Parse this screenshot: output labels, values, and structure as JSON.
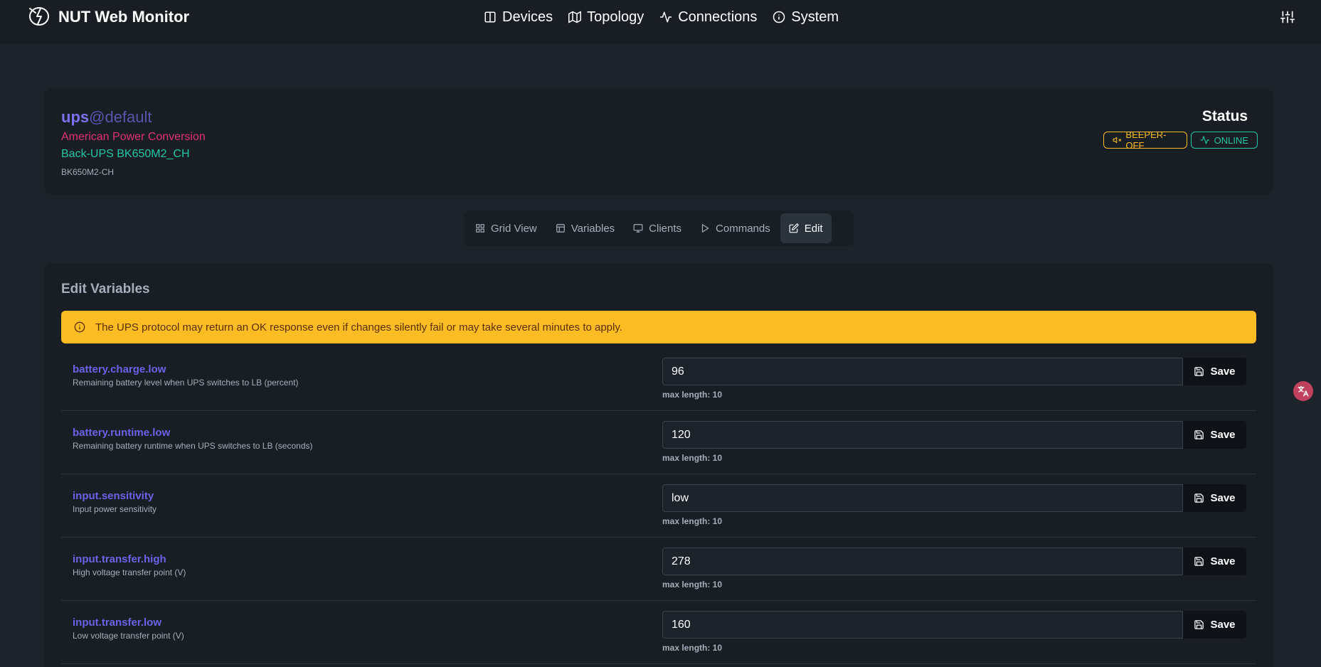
{
  "navbar": {
    "brand_title": "NUT Web Monitor",
    "links": [
      {
        "label": "Devices",
        "icon": "columns-icon"
      },
      {
        "label": "Topology",
        "icon": "map-icon"
      },
      {
        "label": "Connections",
        "icon": "activity-icon"
      },
      {
        "label": "System",
        "icon": "info-icon"
      }
    ]
  },
  "device": {
    "name": "ups",
    "host": "@default",
    "manufacturer": "American Power Conversion",
    "model": "Back-UPS BK650M2_CH",
    "serial": "BK650M2-CH",
    "status_title": "Status",
    "badges": [
      {
        "label": "BEEPER-OFF",
        "color": "#fbbd23"
      },
      {
        "label": "ONLINE",
        "color": "#1fc7a4"
      }
    ]
  },
  "tabs": [
    {
      "label": "Grid View",
      "active": false
    },
    {
      "label": "Variables",
      "active": false
    },
    {
      "label": "Clients",
      "active": false
    },
    {
      "label": "Commands",
      "active": false
    },
    {
      "label": "Edit",
      "active": true
    }
  ],
  "edit": {
    "title": "Edit Variables",
    "alert": "The UPS protocol may return an OK response even if changes silently fail or may take several minutes to apply.",
    "save_label": "Save",
    "variables": [
      {
        "name": "battery.charge.low",
        "description": "Remaining battery level when UPS switches to LB (percent)",
        "value": "96",
        "max": "max length: 10"
      },
      {
        "name": "battery.runtime.low",
        "description": "Remaining battery runtime when UPS switches to LB (seconds)",
        "value": "120",
        "max": "max length: 10"
      },
      {
        "name": "input.sensitivity",
        "description": "Input power sensitivity",
        "value": "low",
        "max": "max length: 10"
      },
      {
        "name": "input.transfer.high",
        "description": "High voltage transfer point (V)",
        "value": "278",
        "max": "max length: 10"
      },
      {
        "name": "input.transfer.low",
        "description": "Low voltage transfer point (V)",
        "value": "160",
        "max": "max length: 10"
      }
    ]
  },
  "colors": {
    "accent": "#7b72f0",
    "warning": "#fbbd23",
    "success": "#1fc7a4",
    "manufacturer": "#e0317a"
  }
}
